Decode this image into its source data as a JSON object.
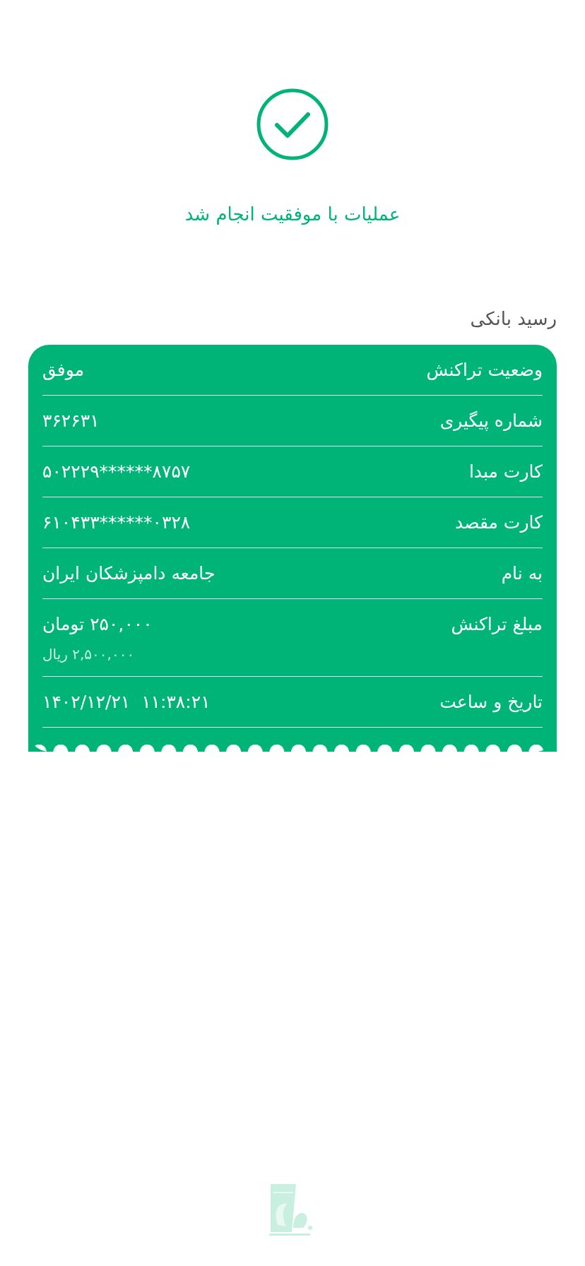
{
  "status": {
    "message": "عملیات با موفقیت انجام شد"
  },
  "receipt": {
    "title": "رسید بانکی",
    "rows": [
      {
        "label": "وضعیت تراکنش",
        "value": "موفق"
      },
      {
        "label": "شماره پیگیری",
        "value": "۳۶۲۶۳۱"
      },
      {
        "label": "کارت مبدا",
        "value": "۵۰۲۲۲۹******۸۷۵۷"
      },
      {
        "label": "کارت مقصد",
        "value": "۶۱۰۴۳۳******۰۳۲۸"
      },
      {
        "label": "به نام",
        "value": "جامعه دامپزشکان ایران"
      },
      {
        "label": "مبلغ تراکنش",
        "value": "۲۵۰,۰۰۰ تومان",
        "sub": "۲,۵۰۰,۰۰۰ ریال"
      },
      {
        "label": "تاریخ و ساعت",
        "value": "۱۴۰۲/۱۲/۲۱  ۱۱:۳۸:۲۱"
      }
    ]
  }
}
